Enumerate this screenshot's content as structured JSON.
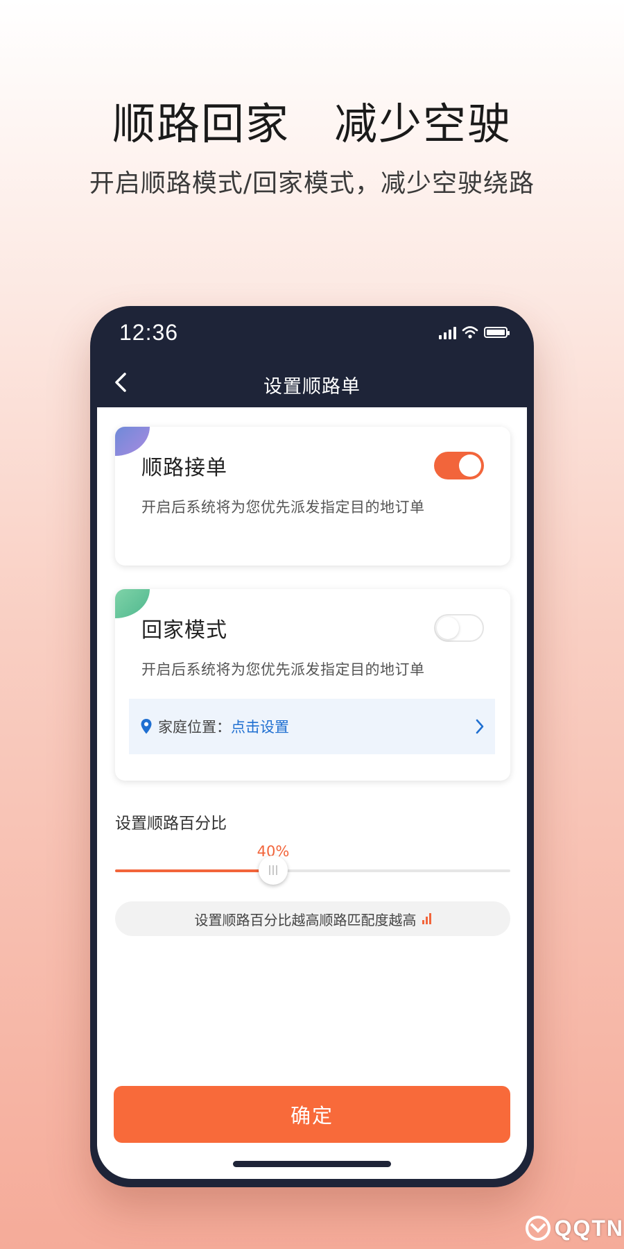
{
  "promo": {
    "headline": "顺路回家　减少空驶",
    "subline": "开启顺路模式/回家模式，减少空驶绕路"
  },
  "status_bar": {
    "time": "12:36"
  },
  "nav": {
    "title": "设置顺路单",
    "back_icon": "chevron-left-icon"
  },
  "cards": {
    "route_order": {
      "title": "顺路接单",
      "description": "开启后系统将为您优先派发指定目的地订单",
      "enabled": true
    },
    "home_mode": {
      "title": "回家模式",
      "description": "开启后系统将为您优先派发指定目的地订单",
      "enabled": false,
      "home_location_label": "家庭位置：",
      "home_location_link": "点击设置"
    }
  },
  "slider": {
    "title": "设置顺路百分比",
    "value_label": "40%",
    "value": 40
  },
  "hint": {
    "text": "设置顺路百分比越高顺路匹配度越高"
  },
  "confirm": {
    "label": "确定"
  },
  "watermark": {
    "text": "QQTN"
  },
  "colors": {
    "accent": "#F2653B",
    "nav_bg": "#1E2438",
    "link": "#1F6FD1"
  }
}
